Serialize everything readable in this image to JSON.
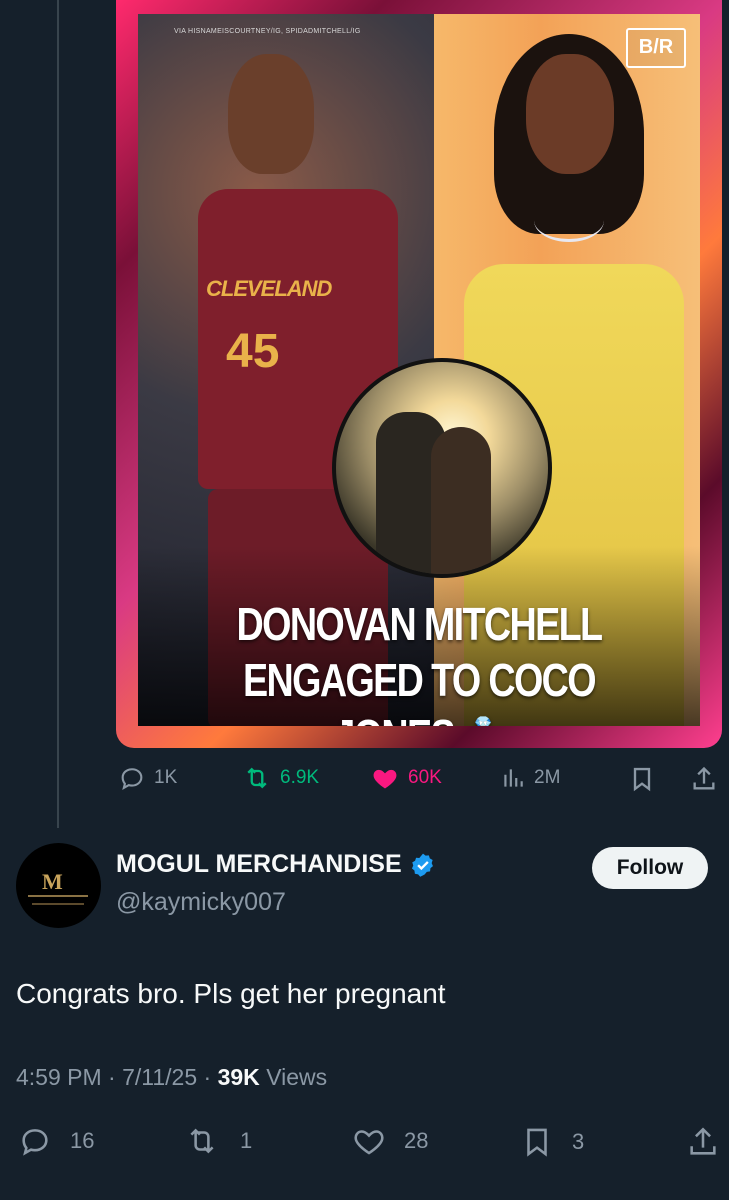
{
  "media": {
    "credit": "VIA HISNAMEISCOURTNEY/IG, SPIDADMITCHELL/IG",
    "logo": "B/R",
    "jersey_text": "CLEVELAND",
    "jersey_number": "45",
    "headline_line1": "DONOVAN MITCHELL",
    "headline_line2": "ENGAGED TO COCO JONES",
    "ring_emoji": "💍"
  },
  "top_tweet_actions": {
    "replies": "1K",
    "reposts": "6.9K",
    "likes": "60K",
    "views": "2M"
  },
  "reply": {
    "name": "MOGUL MERCHANDISE",
    "handle": "@kaymicky007",
    "follow_label": "Follow",
    "avatar_text": "M",
    "text": "Congrats bro. Pls get her pregnant",
    "time": "4:59 PM",
    "date": "7/11/25",
    "views_count": "39K",
    "views_label": "Views",
    "replies": "16",
    "reposts": "1",
    "likes": "28",
    "bookmarks": "3"
  },
  "colors": {
    "background": "#15202b",
    "muted": "#8b98a5",
    "repost_green": "#00ba7c",
    "like_pink": "#f91880",
    "verified_blue": "#1d9bf0"
  }
}
